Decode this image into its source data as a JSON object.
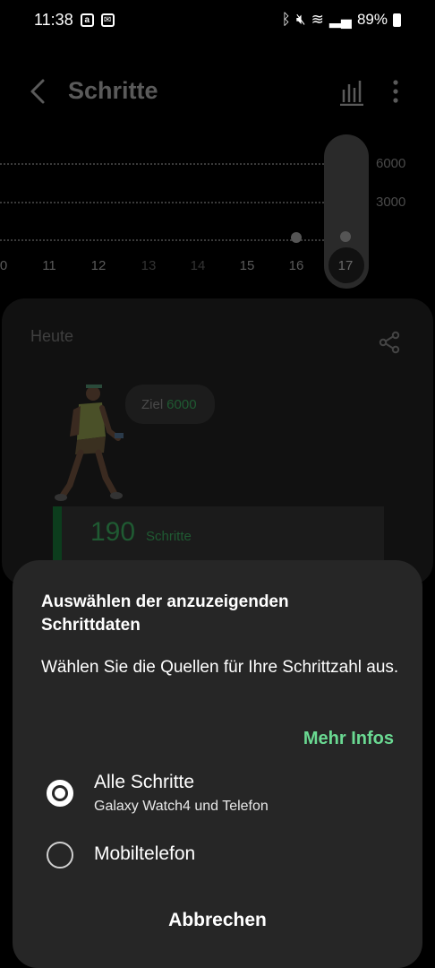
{
  "status_bar": {
    "time": "11:38",
    "battery": "89%"
  },
  "header": {
    "title": "Schritte"
  },
  "chart_data": {
    "type": "scatter",
    "x": [
      "0",
      "11",
      "12",
      "13",
      "14",
      "15",
      "16",
      "17"
    ],
    "y_ticks": [
      "6000",
      "3000"
    ],
    "selected": "17",
    "points": [
      {
        "x": "16",
        "y": 150
      },
      {
        "x": "17",
        "y": 190
      }
    ]
  },
  "card": {
    "today_label": "Heute",
    "goal_label": "Ziel",
    "goal_value": "6000",
    "steps_value": "190",
    "steps_unit": "Schritte"
  },
  "sheet": {
    "title": "Auswählen der anzuzeigenden Schrittdaten",
    "description": "Wählen Sie die Quellen für Ihre Schrittzahl aus.",
    "more_info": "Mehr Infos",
    "options": [
      {
        "label": "Alle Schritte",
        "sub": "Galaxy Watch4 und Telefon",
        "selected": true
      },
      {
        "label": "Mobiltelefon",
        "sub": "",
        "selected": false
      }
    ],
    "cancel": "Abbrechen"
  }
}
